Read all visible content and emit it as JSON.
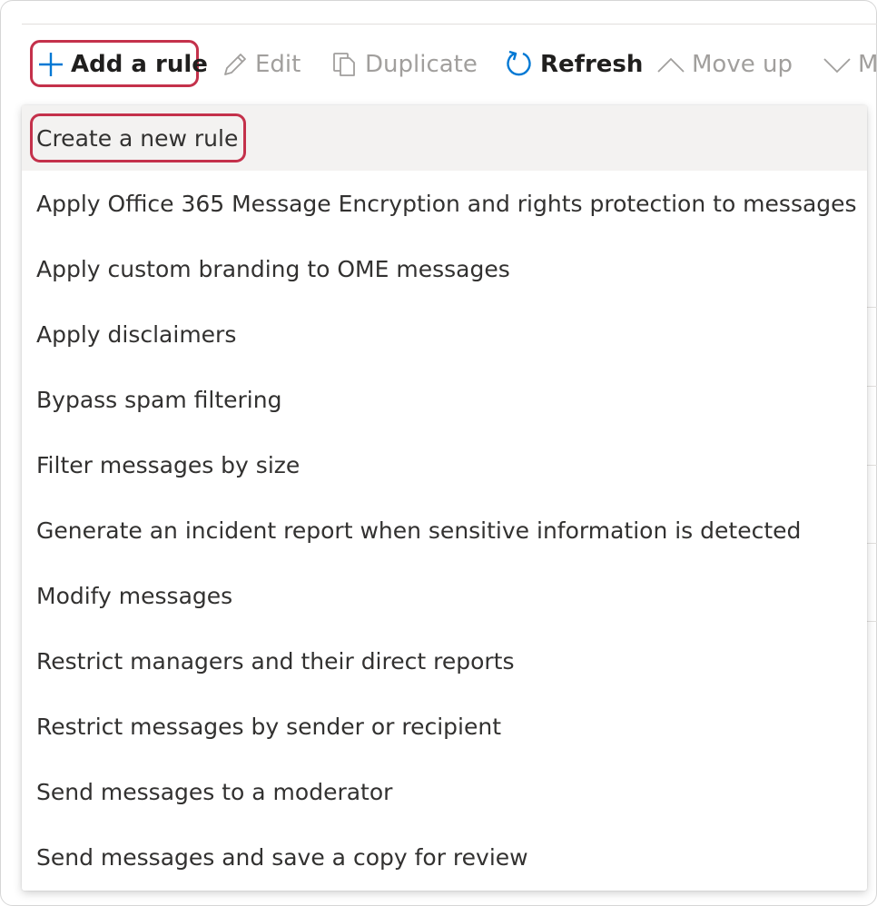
{
  "toolbar": {
    "add_rule_label": "Add a rule",
    "edit_label": "Edit",
    "duplicate_label": "Duplicate",
    "refresh_label": "Refresh",
    "move_up_label": "Move up",
    "move_down_label": "M"
  },
  "icons": {
    "add": "plus-icon",
    "edit": "pencil-icon",
    "duplicate": "copy-icon",
    "refresh": "refresh-icon",
    "move_up": "chevron-up-icon",
    "move_down": "chevron-down-icon"
  },
  "colors": {
    "highlight": "#c4314b",
    "accent": "#0078d4",
    "disabled": "#a19f9d",
    "selected_bg": "#f3f2f1"
  },
  "menu": {
    "selected_index": 0,
    "items": [
      {
        "label": "Create a new rule"
      },
      {
        "label": "Apply Office 365 Message Encryption and rights protection to messages"
      },
      {
        "label": "Apply custom branding to OME messages"
      },
      {
        "label": "Apply disclaimers"
      },
      {
        "label": "Bypass spam filtering"
      },
      {
        "label": "Filter messages by size"
      },
      {
        "label": "Generate an incident report when sensitive information is detected"
      },
      {
        "label": "Modify messages"
      },
      {
        "label": "Restrict managers and their direct reports"
      },
      {
        "label": "Restrict messages by sender or recipient"
      },
      {
        "label": "Send messages to a moderator"
      },
      {
        "label": "Send messages and save a copy for review"
      }
    ]
  }
}
